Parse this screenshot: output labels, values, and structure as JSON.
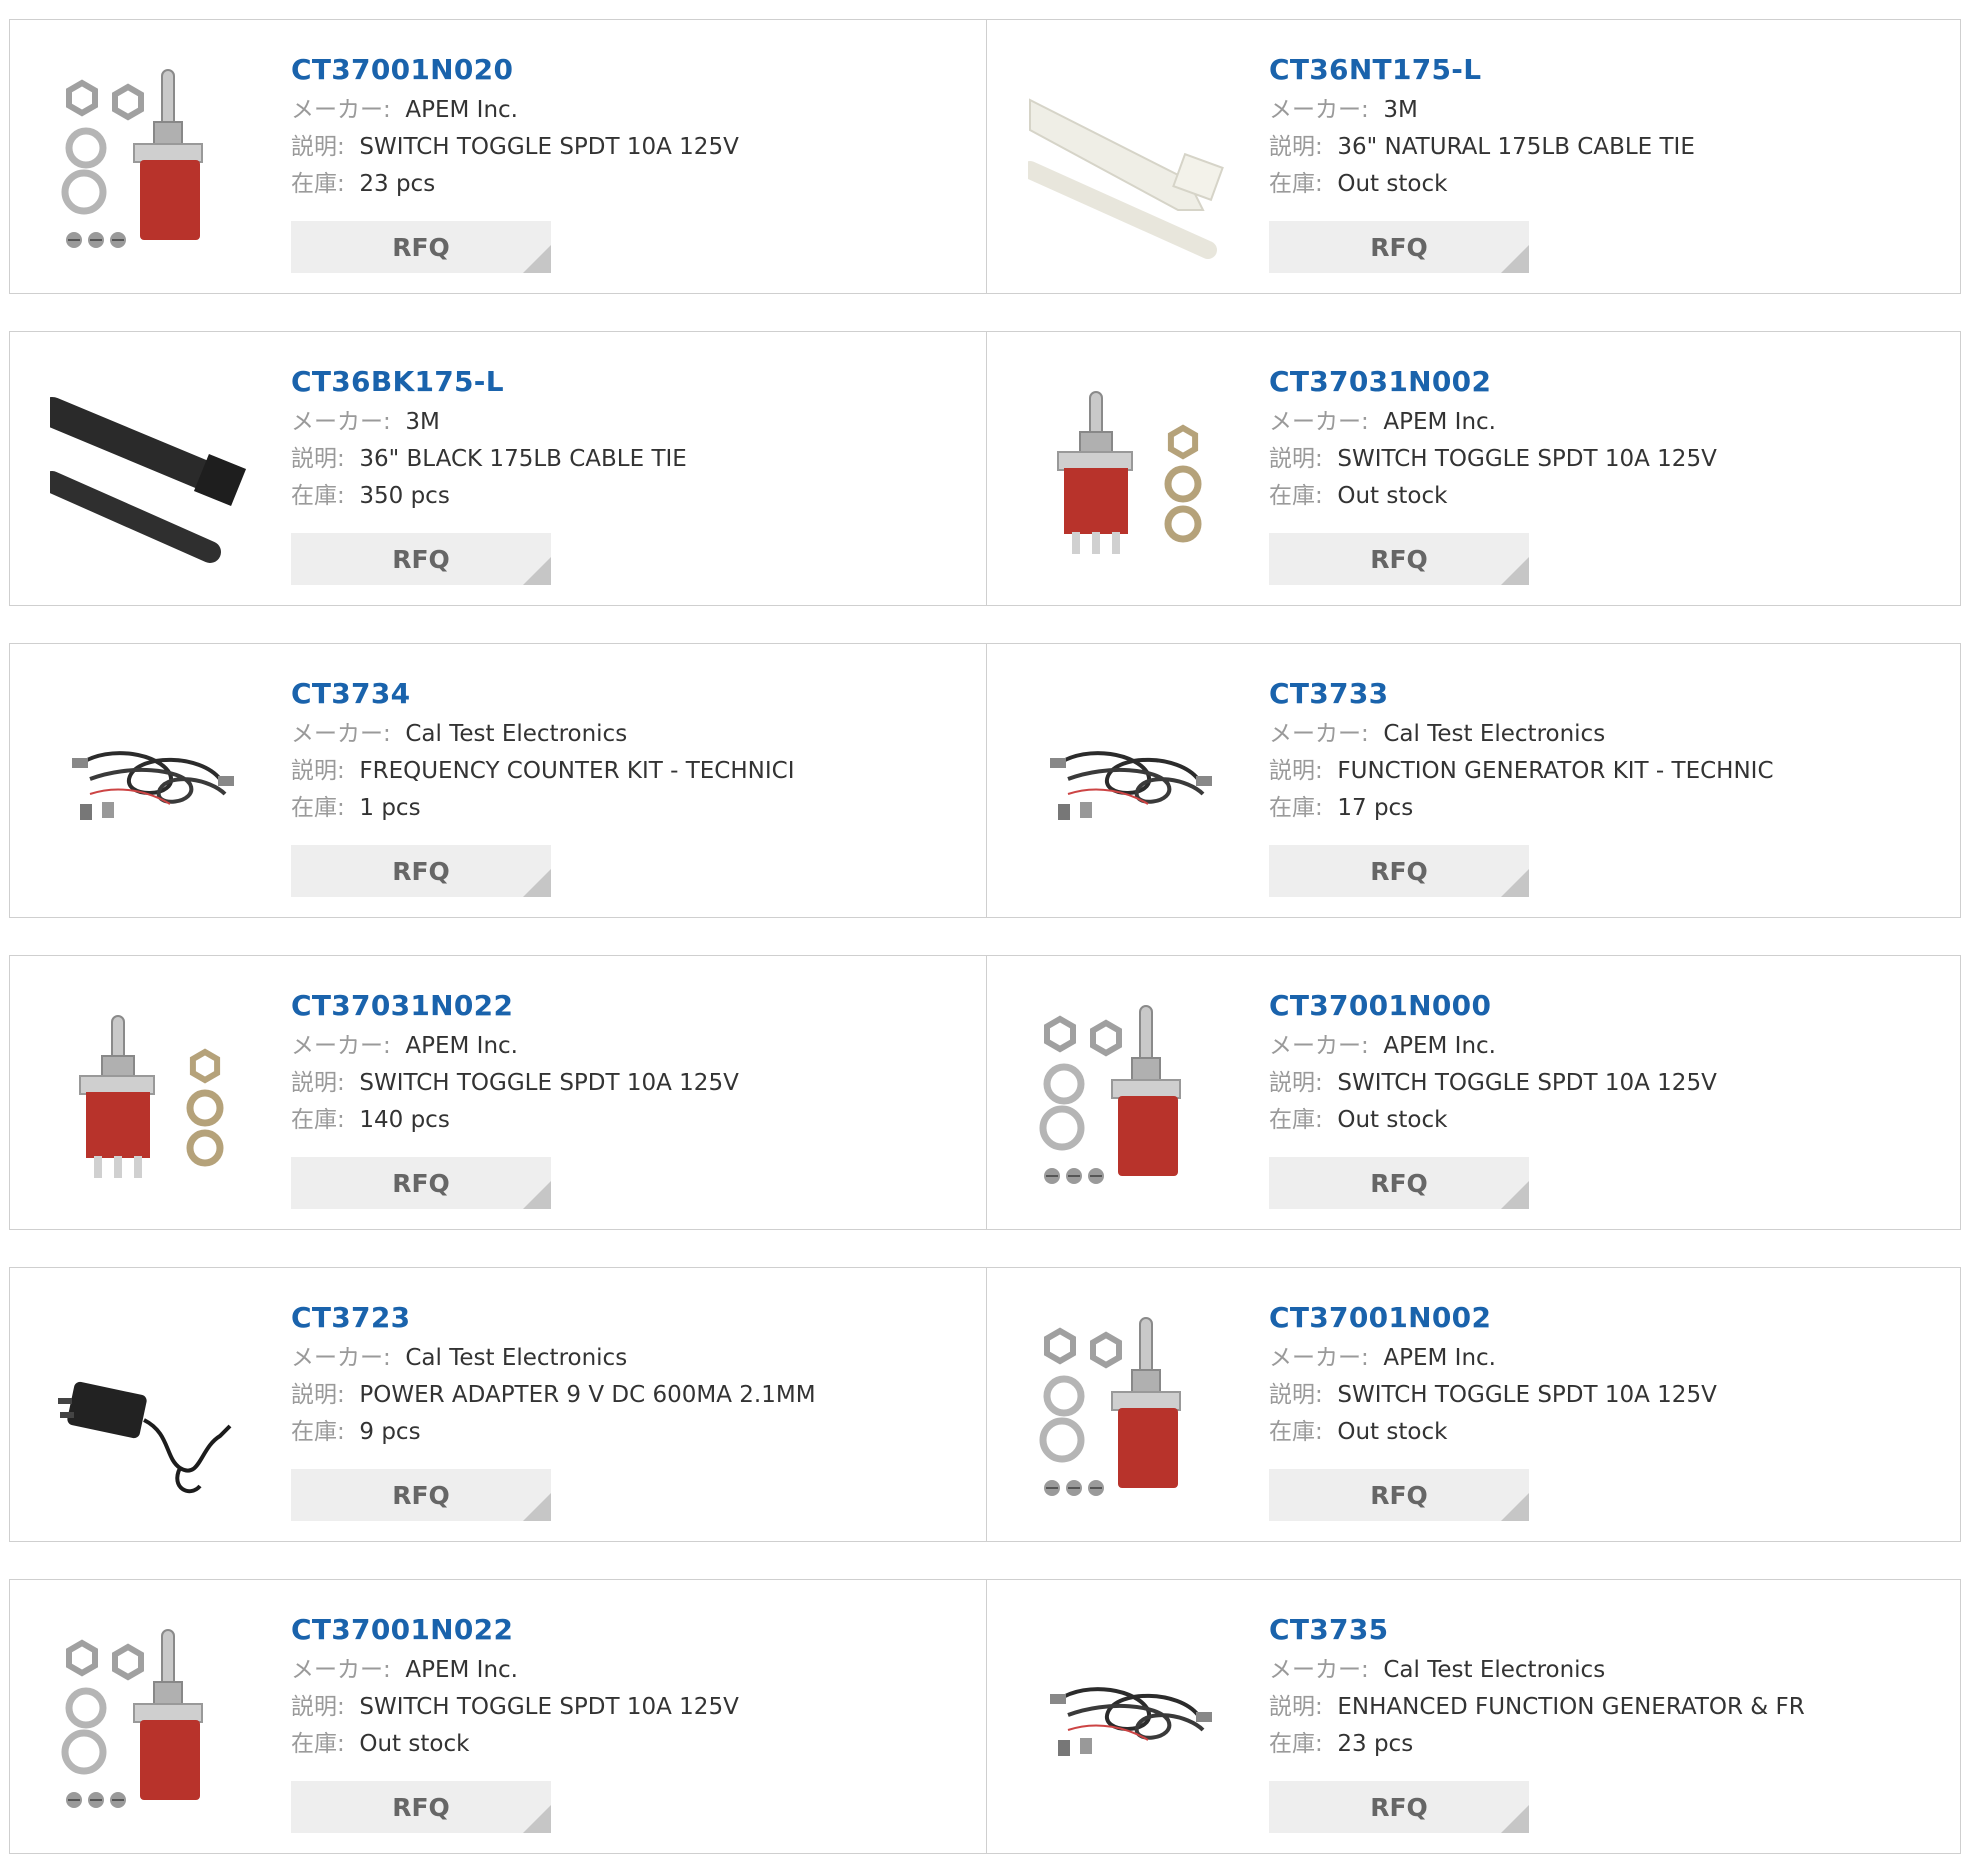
{
  "labels": {
    "maker": "メーカー:",
    "description": "説明:",
    "stock": "在庫:",
    "rfq": "RFQ"
  },
  "products": [
    {
      "part": "CT37001N020",
      "maker": "APEM Inc.",
      "desc": "SWITCH TOGGLE SPDT 10A 125V",
      "stock": "23 pcs",
      "image": "toggle-switch-with-nuts"
    },
    {
      "part": "CT36NT175-L",
      "maker": "3M",
      "desc": "36\" NATURAL 175LB CABLE TIE",
      "stock": "Out stock",
      "image": "natural-cable-tie"
    },
    {
      "part": "CT36BK175-L",
      "maker": "3M",
      "desc": "36\" BLACK 175LB CABLE TIE",
      "stock": "350 pcs",
      "image": "black-cable-tie"
    },
    {
      "part": "CT37031N002",
      "maker": "APEM Inc.",
      "desc": "SWITCH TOGGLE SPDT 10A 125V",
      "stock": "Out stock",
      "image": "toggle-switch-with-tabs"
    },
    {
      "part": "CT3734",
      "maker": "Cal Test Electronics",
      "desc": "FREQUENCY COUNTER KIT - TECHNICI",
      "stock": "1 pcs",
      "image": "test-lead-kit"
    },
    {
      "part": "CT3733",
      "maker": "Cal Test Electronics",
      "desc": "FUNCTION GENERATOR KIT - TECHNIC",
      "stock": "17 pcs",
      "image": "test-lead-kit"
    },
    {
      "part": "CT37031N022",
      "maker": "APEM Inc.",
      "desc": "SWITCH TOGGLE SPDT 10A 125V",
      "stock": "140 pcs",
      "image": "toggle-switch-with-tabs"
    },
    {
      "part": "CT37001N000",
      "maker": "APEM Inc.",
      "desc": "SWITCH TOGGLE SPDT 10A 125V",
      "stock": "Out stock",
      "image": "toggle-switch-with-nuts"
    },
    {
      "part": "CT3723",
      "maker": "Cal Test Electronics",
      "desc": "POWER ADAPTER 9 V DC 600MA 2.1MM",
      "stock": "9 pcs",
      "image": "power-adapter"
    },
    {
      "part": "CT37001N002",
      "maker": "APEM Inc.",
      "desc": "SWITCH TOGGLE SPDT 10A 125V",
      "stock": "Out stock",
      "image": "toggle-switch-with-nuts"
    },
    {
      "part": "CT37001N022",
      "maker": "APEM Inc.",
      "desc": "SWITCH TOGGLE SPDT 10A 125V",
      "stock": "Out stock",
      "image": "toggle-switch-with-nuts"
    },
    {
      "part": "CT3735",
      "maker": "Cal Test Electronics",
      "desc": "ENHANCED FUNCTION GENERATOR & FR",
      "stock": "23 pcs",
      "image": "test-lead-kit"
    }
  ],
  "colors": {
    "part_link": "#1a63ac",
    "label": "#9a9a9a",
    "value": "#333333",
    "border": "#cfcfcf",
    "rfq_bg": "#eeeeee",
    "rfq_text": "#666666",
    "switch_body": "#b8332b"
  }
}
